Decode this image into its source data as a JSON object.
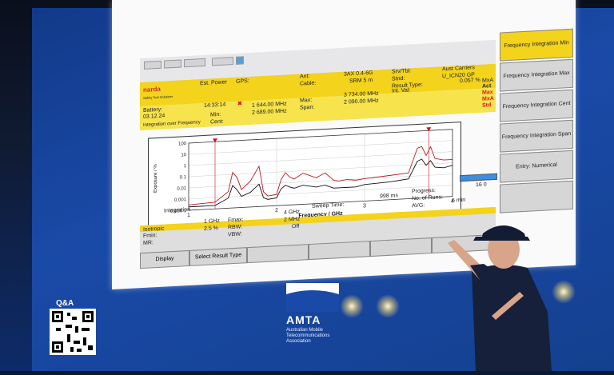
{
  "window": {
    "brand": "narda",
    "brand_sub": "Safety Test Solutions"
  },
  "header": {
    "battery_label": "Battery:",
    "battery_value": "03.12.24",
    "est_power_label": "Est. Power",
    "gps_label": "GPS:",
    "time_value": "14:33:14",
    "ant_label": "Ant:",
    "ant_value": "3AX 0.4-6G",
    "cable_label": "Cable:",
    "cable_value": "SRM 5 m",
    "srv_tbl_label": "Srv/Tbl:",
    "srv_tbl_value": "Aust Carriers",
    "stnd_label": "Stnd:",
    "stnd_value": "U_ICN20 GP",
    "mode_value": "MxA",
    "result_type_label": "Result Type:",
    "result_value": "0.057 %",
    "int_val_label": "Int. Val:",
    "measure_label": "Integration over Frequency",
    "min_label": "Min:",
    "min_value": "1 644.00 MHz",
    "max_label": "Max:",
    "max_value": "3 734.00 MHz",
    "cent_label": "Cent:",
    "cent_value": "2 689.00 MHz",
    "span_label": "Span:",
    "span_value": "2 090.00 MHz",
    "traces": [
      "Act",
      "Max",
      "MxA",
      "Std"
    ]
  },
  "chart_data": {
    "type": "line",
    "title": "",
    "xlabel": "Frequency / GHz",
    "ylabel": "Exposure / %",
    "x_ticks": [
      "1",
      "2",
      "3",
      "4"
    ],
    "y_ticks": [
      "100",
      "10",
      "1",
      "0.1",
      "0.01",
      "0.001",
      "0.000 1"
    ],
    "xlim": [
      1,
      4
    ],
    "ylim_log": [
      0.0001,
      100
    ],
    "legend": "",
    "series": [
      {
        "name": "Max",
        "color": "#c0161e",
        "x": [
          1.0,
          1.3,
          1.45,
          1.5,
          1.55,
          1.6,
          1.7,
          1.8,
          1.85,
          1.9,
          2.0,
          2.05,
          2.1,
          2.15,
          2.2,
          2.3,
          2.45,
          2.55,
          2.65,
          2.7,
          2.8,
          2.9,
          3.0,
          3.3,
          3.5,
          3.6,
          3.65,
          3.7,
          3.75,
          3.8,
          3.9,
          4.0
        ],
        "y": [
          0.0003,
          0.0004,
          0.003,
          0.15,
          0.05,
          0.004,
          0.02,
          0.4,
          0.002,
          0.0008,
          0.001,
          0.02,
          0.08,
          0.03,
          0.02,
          0.06,
          0.02,
          0.05,
          0.01,
          0.008,
          0.01,
          0.008,
          0.01,
          0.015,
          0.02,
          3.0,
          4.0,
          0.6,
          3.5,
          0.3,
          0.2,
          0.2
        ]
      },
      {
        "name": "Act",
        "color": "#111111",
        "x": [
          1.0,
          1.3,
          1.45,
          1.5,
          1.55,
          1.6,
          1.7,
          1.8,
          1.85,
          1.9,
          2.0,
          2.05,
          2.1,
          2.15,
          2.2,
          2.3,
          2.45,
          2.55,
          2.65,
          2.7,
          2.8,
          2.9,
          3.0,
          3.3,
          3.5,
          3.6,
          3.65,
          3.7,
          3.75,
          3.8,
          3.9,
          4.0
        ],
        "y": [
          0.0002,
          0.0002,
          0.0008,
          0.01,
          0.004,
          0.001,
          0.002,
          0.01,
          0.0006,
          0.0004,
          0.0005,
          0.003,
          0.006,
          0.004,
          0.003,
          0.005,
          0.003,
          0.004,
          0.002,
          0.002,
          0.002,
          0.002,
          0.003,
          0.004,
          0.006,
          0.2,
          0.3,
          0.08,
          0.2,
          0.05,
          0.04,
          0.06
        ]
      }
    ],
    "markers": [
      {
        "x": 1.3,
        "label": "min"
      },
      {
        "x": 3.73,
        "label": "max"
      }
    ]
  },
  "footer": {
    "isotropic": "Isotropic",
    "integration": "Integration",
    "fmin_label": "Fmin:",
    "fmin_value": "1 GHz",
    "fmax_label": "Fmax:",
    "fmax_value": "4 GHz",
    "mr_label": "MR:",
    "mr_value": "2.5 %",
    "rbw_label": "RBW:",
    "rbw_value": "2 MHz",
    "vbw_label": "VBW:",
    "vbw_value": "Off",
    "sweep_label": "Sweep Time:",
    "sweep_value": "998 ms",
    "progress_label": "Progress:",
    "runs_label": "No. of Runs:",
    "runs_value": "16 0",
    "avg_label": "AVG:",
    "avg_value": "6 min"
  },
  "softkeys": [
    "Frequency Integration Min",
    "Frequency Integration Max",
    "Frequency Integration Cent",
    "Frequency Integration Span",
    "Entry: Numerical"
  ],
  "bottom_keys": [
    "Display",
    "Select Result Type"
  ],
  "slide": {
    "qa": "Q&A",
    "amta": "AMTA",
    "amta_sub_1": "Australian Mobile",
    "amta_sub_2": "Telecommunications",
    "amta_sub_3": "Association"
  }
}
